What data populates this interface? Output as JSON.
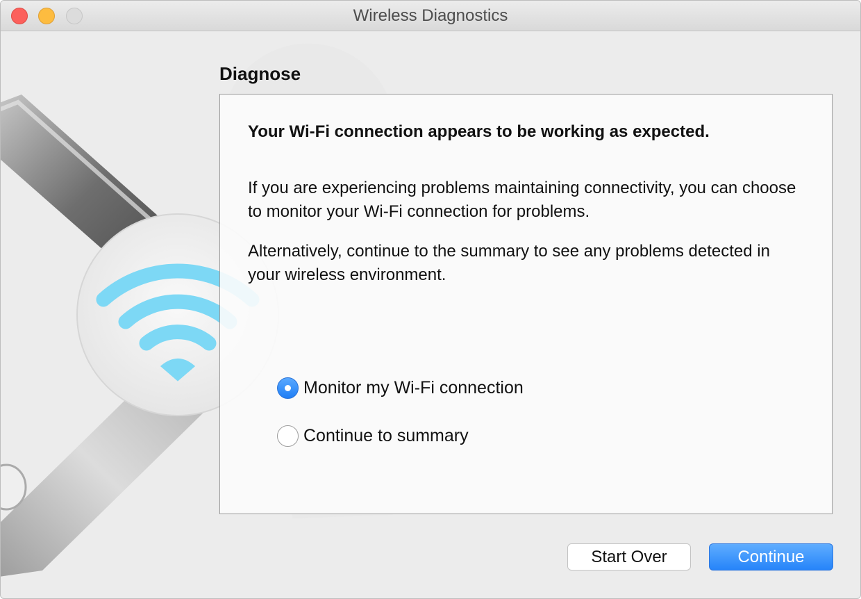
{
  "window": {
    "title": "Wireless Diagnostics"
  },
  "page": {
    "heading": "Diagnose"
  },
  "panel": {
    "headline": "Your Wi-Fi connection appears to be working as expected.",
    "paragraphs": [
      "If you are experiencing problems maintaining connectivity, you can choose to monitor your Wi-Fi connection for problems.",
      "Alternatively, continue to the summary to see any problems detected in your wireless environment."
    ],
    "options": [
      {
        "label": "Monitor my Wi-Fi connection",
        "selected": true
      },
      {
        "label": "Continue to summary",
        "selected": false
      }
    ]
  },
  "buttons": {
    "start_over": "Start Over",
    "continue": "Continue"
  },
  "colors": {
    "accent": "#2684f9",
    "wifi_icon": "#7dd8f5"
  },
  "icons": [
    "close-button",
    "minimize-button",
    "zoom-button",
    "wrench-icon",
    "wifi-icon"
  ]
}
